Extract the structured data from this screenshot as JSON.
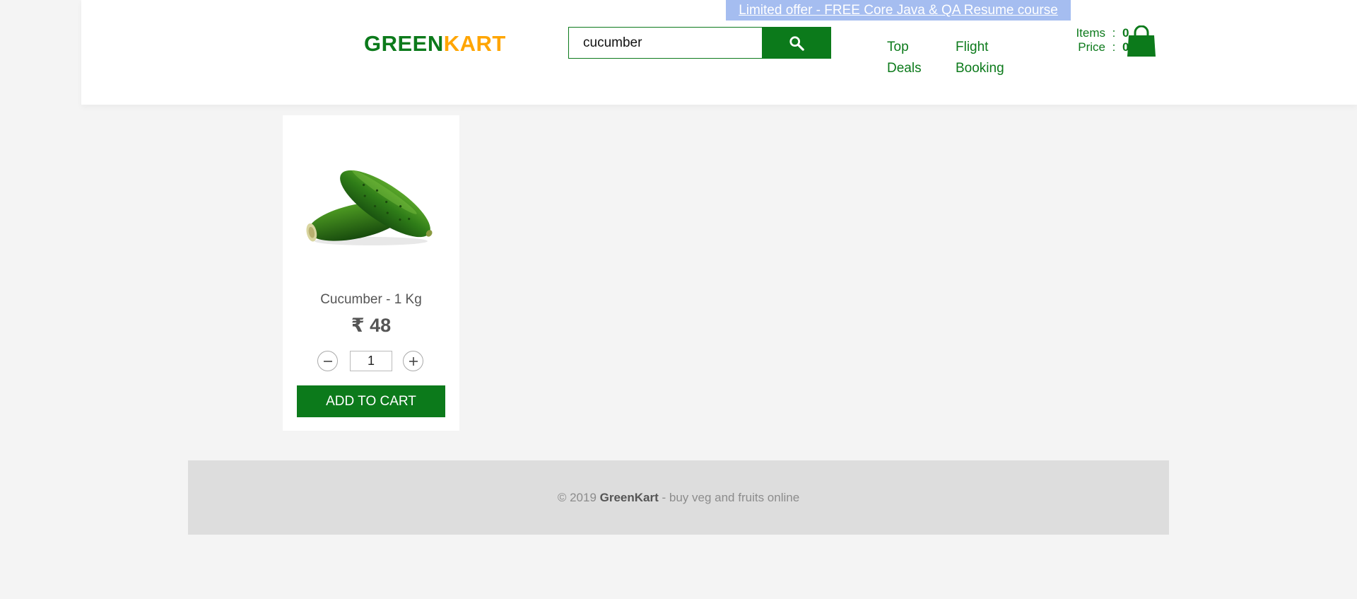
{
  "header": {
    "logo_part1": "GREEN",
    "logo_part2": "KART",
    "promo_link": "Limited offer - FREE Core Java & QA Resume course",
    "search": {
      "value": "cucumber",
      "button_icon": "search-icon"
    },
    "nav": {
      "top_deals_line1": "Top",
      "top_deals_line2": "Deals",
      "flight_booking_line1": "Flight",
      "flight_booking_line2": "Booking"
    },
    "cart": {
      "items_label": "Items",
      "items_value": "0",
      "price_label": "Price",
      "price_value": "0",
      "separator": ":",
      "icon": "shopping-bag-icon"
    }
  },
  "products": [
    {
      "name": "Cucumber - 1 Kg",
      "price": "₹ 48",
      "quantity": "1",
      "add_button": "ADD TO CART"
    }
  ],
  "footer": {
    "prefix": "© 2019 ",
    "brand": "GreenKart",
    "suffix": " - buy veg and fruits online"
  },
  "colors": {
    "brand_green": "#0c7a1b",
    "brand_orange": "#ffa500",
    "promo_bg": "#a5bdf0",
    "page_bg": "#f4f4f4",
    "footer_bg": "#dddddd"
  }
}
